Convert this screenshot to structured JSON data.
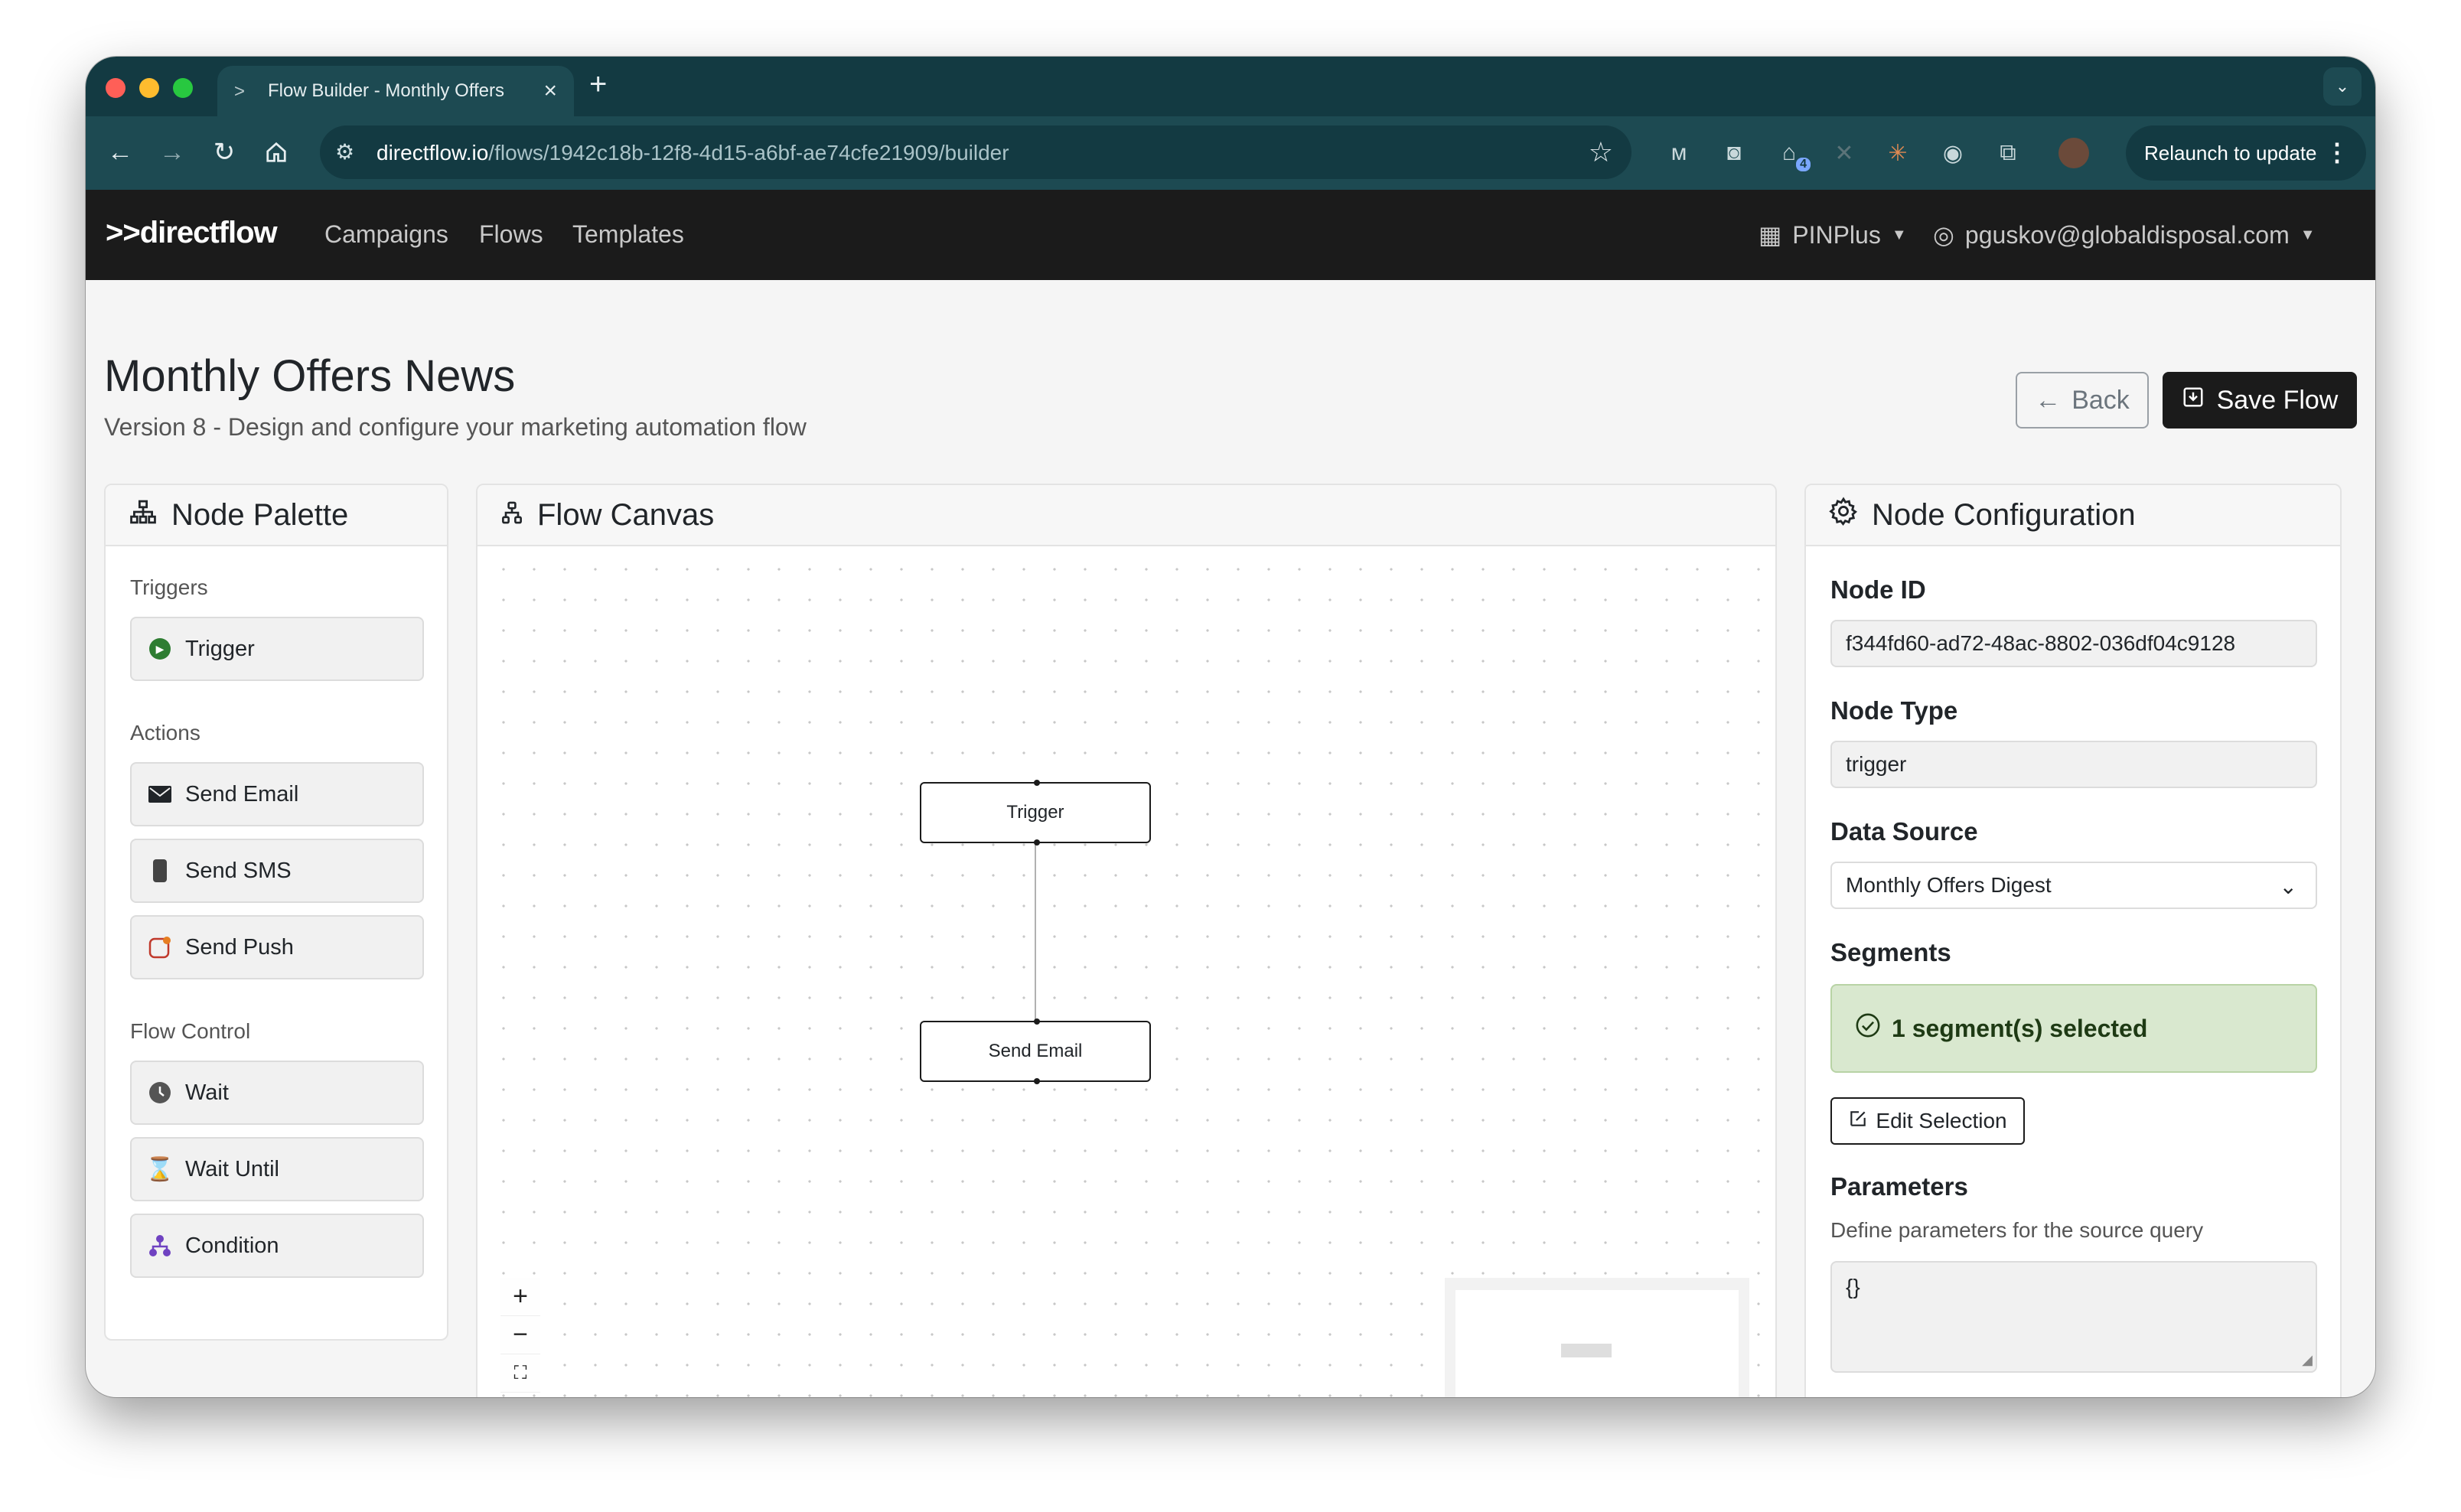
{
  "browser": {
    "tab_title": "Flow Builder - Monthly Offers",
    "url_host": "directflow.io",
    "url_path": "/flows/1942c18b-12f8-4d15-a6bf-ae74cfe21909/builder",
    "extension_badge": "4",
    "relaunch_label": "Relaunch to update"
  },
  "app": {
    "brand": "directflow",
    "nav": [
      "Campaigns",
      "Flows",
      "Templates"
    ],
    "org": "PINPlus",
    "user": "pguskov@globaldisposal.com"
  },
  "page": {
    "title": "Monthly Offers News",
    "subtitle": "Version 8 - Design and configure your marketing automation flow",
    "back_label": "Back",
    "save_label": "Save Flow"
  },
  "palette": {
    "title": "Node Palette",
    "sections": [
      {
        "label": "Triggers",
        "items": [
          "Trigger"
        ]
      },
      {
        "label": "Actions",
        "items": [
          "Send Email",
          "Send SMS",
          "Send Push"
        ]
      },
      {
        "label": "Flow Control",
        "items": [
          "Wait",
          "Wait Until",
          "Condition"
        ]
      }
    ]
  },
  "canvas": {
    "title": "Flow Canvas",
    "nodes": [
      "Trigger",
      "Send Email"
    ],
    "zoom_in": "+",
    "zoom_out": "−"
  },
  "config": {
    "title": "Node Configuration",
    "node_id_label": "Node ID",
    "node_id": "f344fd60-ad72-48ac-8802-036df04c9128",
    "node_type_label": "Node Type",
    "node_type": "trigger",
    "data_source_label": "Data Source",
    "data_source": "Monthly Offers Digest",
    "segments_label": "Segments",
    "segments_status": "1 segment(s) selected",
    "edit_label": "Edit Selection",
    "parameters_label": "Parameters",
    "parameters_help": "Define parameters for the source query",
    "parameters_value": "{}"
  },
  "colors": {
    "browser_frame": "#133a42",
    "browser_toolbar": "#1d4a52",
    "app_nav": "#1b1b1b",
    "trigger_green": "#2e7d32",
    "success_bg": "#d9e8cf",
    "condition_purple": "#6f42c1",
    "wait_until_orange": "#d18a00"
  }
}
